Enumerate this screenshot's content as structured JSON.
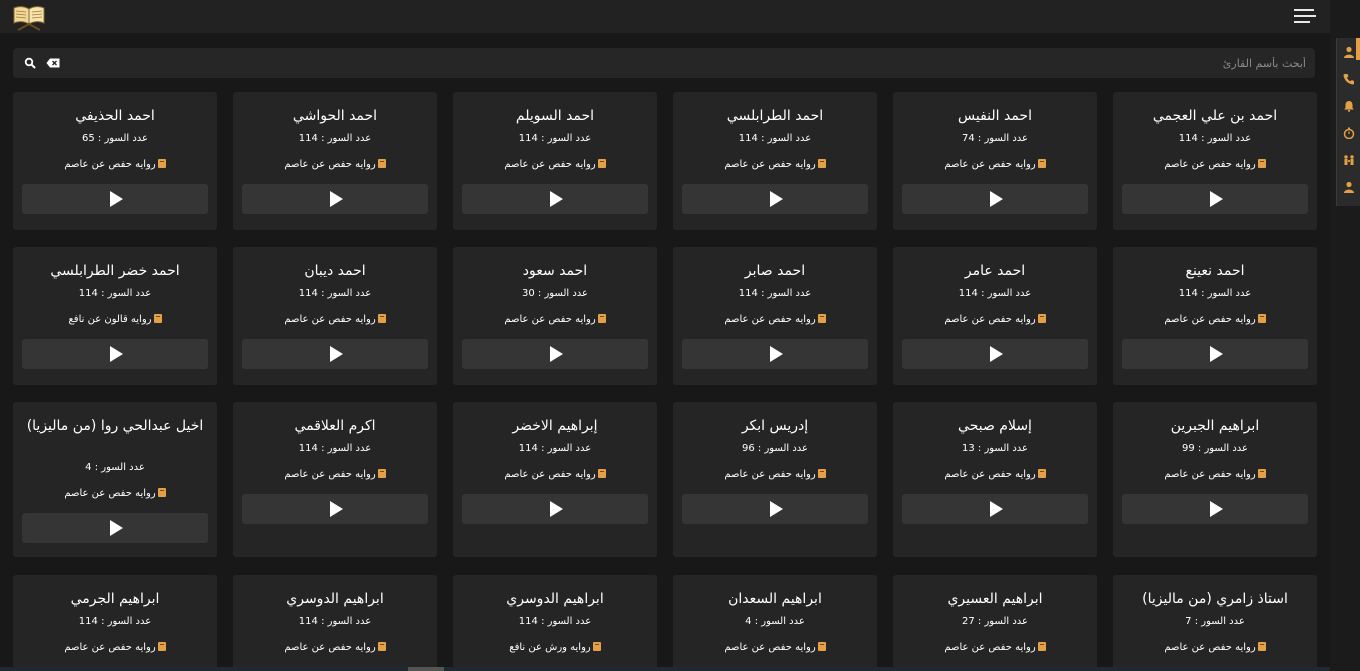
{
  "header": {
    "logo_icon": "quran-book-logo-icon",
    "menu_icon": "hamburger-menu-icon"
  },
  "search": {
    "placeholder": "أبحث بأسم القارئ"
  },
  "sidebar_icons": [
    "user-icon",
    "phone-icon",
    "bell-icon",
    "stopwatch-icon",
    "family-icon",
    "user-icon"
  ],
  "accent_color": "#e3a046",
  "count_prefix": "عدد السور :",
  "reciters": [
    {
      "name": "احمد بن علي العجمي",
      "count": "114",
      "narration": "روايه حفص عن عاصم"
    },
    {
      "name": "احمد النفيس",
      "count": "74",
      "narration": "روايه حفص عن عاصم"
    },
    {
      "name": "احمد الطرابلسي",
      "count": "114",
      "narration": "روايه حفص عن عاصم"
    },
    {
      "name": "احمد السويلم",
      "count": "114",
      "narration": "روايه حفص عن عاصم"
    },
    {
      "name": "احمد الحواشي",
      "count": "114",
      "narration": "روايه حفص عن عاصم"
    },
    {
      "name": "احمد الحذيفي",
      "count": "65",
      "narration": "روايه حفص عن عاصم"
    },
    {
      "name": "احمد نعينع",
      "count": "114",
      "narration": "روايه حفص عن عاصم"
    },
    {
      "name": "احمد عامر",
      "count": "114",
      "narration": "روايه حفص عن عاصم"
    },
    {
      "name": "احمد صابر",
      "count": "114",
      "narration": "روايه حفص عن عاصم"
    },
    {
      "name": "احمد سعود",
      "count": "30",
      "narration": "روايه حفص عن عاصم"
    },
    {
      "name": "احمد ديبان",
      "count": "114",
      "narration": "روايه حفص عن عاصم"
    },
    {
      "name": "احمد خضر الطرابلسي",
      "count": "114",
      "narration": "روايه قالون عن نافع"
    },
    {
      "name": "ابراهيم الجبرين",
      "count": "99",
      "narration": "روايه حفص عن عاصم"
    },
    {
      "name": "إسلام صبحي",
      "count": "13",
      "narration": "روايه حفص عن عاصم"
    },
    {
      "name": "إدريس ابكر",
      "count": "96",
      "narration": "روايه حفص عن عاصم"
    },
    {
      "name": "إبراهيم الاخضر",
      "count": "114",
      "narration": "روايه حفص عن عاصم"
    },
    {
      "name": "اكرم العلاقمي",
      "count": "114",
      "narration": "روايه حفص عن عاصم"
    },
    {
      "name": "اخيل عبدالحي روا (من ماليزيا)",
      "count": "4",
      "narration": "روايه حفص عن عاصم"
    },
    {
      "name": "استاذ زامري (من ماليزيا)",
      "count": "7",
      "narration": "روايه حفص عن عاصم"
    },
    {
      "name": "ابراهيم العسيري",
      "count": "27",
      "narration": "روايه حفص عن عاصم"
    },
    {
      "name": "ابراهيم السعدان",
      "count": "4",
      "narration": "روايه حفص عن عاصم"
    },
    {
      "name": "ابراهيم الدوسري",
      "count": "114",
      "narration": "روايه ورش عن نافع"
    },
    {
      "name": "ابراهيم الدوسري",
      "count": "114",
      "narration": "روايه حفص عن عاصم"
    },
    {
      "name": "ابراهيم الجرمي",
      "count": "114",
      "narration": "روايه حفص عن عاصم"
    }
  ]
}
